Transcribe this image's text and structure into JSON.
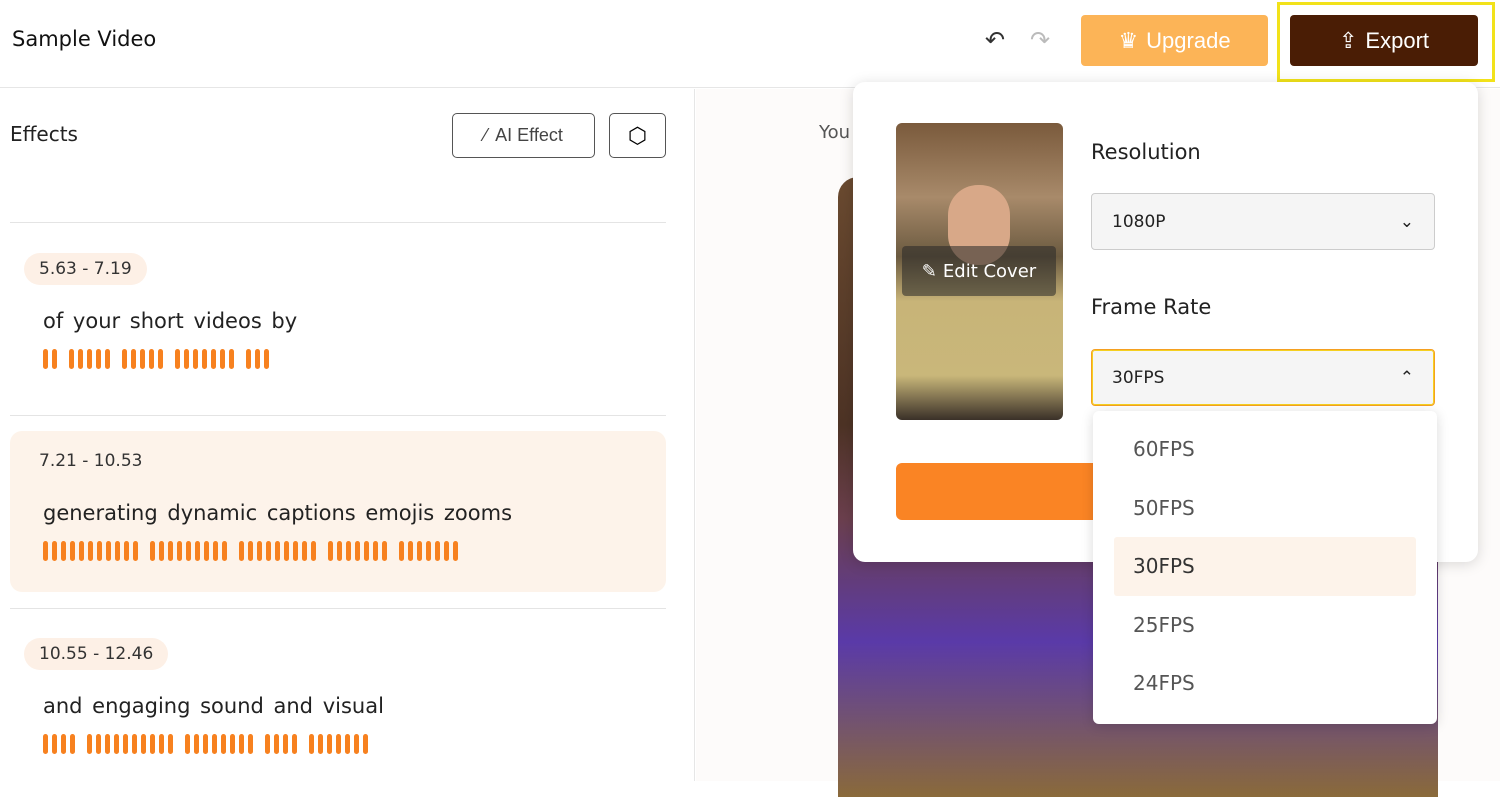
{
  "header": {
    "title": "Sample Video",
    "undo_icon": "undo-icon",
    "redo_icon": "redo-icon",
    "upgrade_label": "Upgrade",
    "export_label": "Export"
  },
  "effects": {
    "title": "Effects",
    "ai_effect_label": "AI Effect",
    "segments": [
      {
        "time": "5.63 - 7.19",
        "text": "of your  short videos  by",
        "wave": [
          2,
          5,
          5,
          7,
          3
        ],
        "active": false
      },
      {
        "time": "7.21 - 10.53",
        "text": "generating dynamic captions emojis zooms",
        "wave": [
          11,
          9,
          9,
          7,
          7
        ],
        "active": true
      },
      {
        "time": "10.55 - 12.46",
        "text": "and engaging sound  and visual",
        "wave": [
          4,
          10,
          8,
          4,
          7
        ],
        "active": false
      }
    ]
  },
  "preview": {
    "label_partial": "You"
  },
  "export_panel": {
    "edit_cover_label": "Edit Cover",
    "resolution_label": "Resolution",
    "resolution_value": "1080P",
    "frame_rate_label": "Frame Rate",
    "frame_rate_value": "30FPS",
    "frame_rate_options": [
      "60FPS",
      "50FPS",
      "30FPS",
      "25FPS",
      "24FPS"
    ],
    "selected_option": "30FPS"
  },
  "colors": {
    "accent": "#f7811f",
    "export_bg": "#4a1d05",
    "upgrade_bg": "#fcb457",
    "highlight": "#f2e21a"
  }
}
